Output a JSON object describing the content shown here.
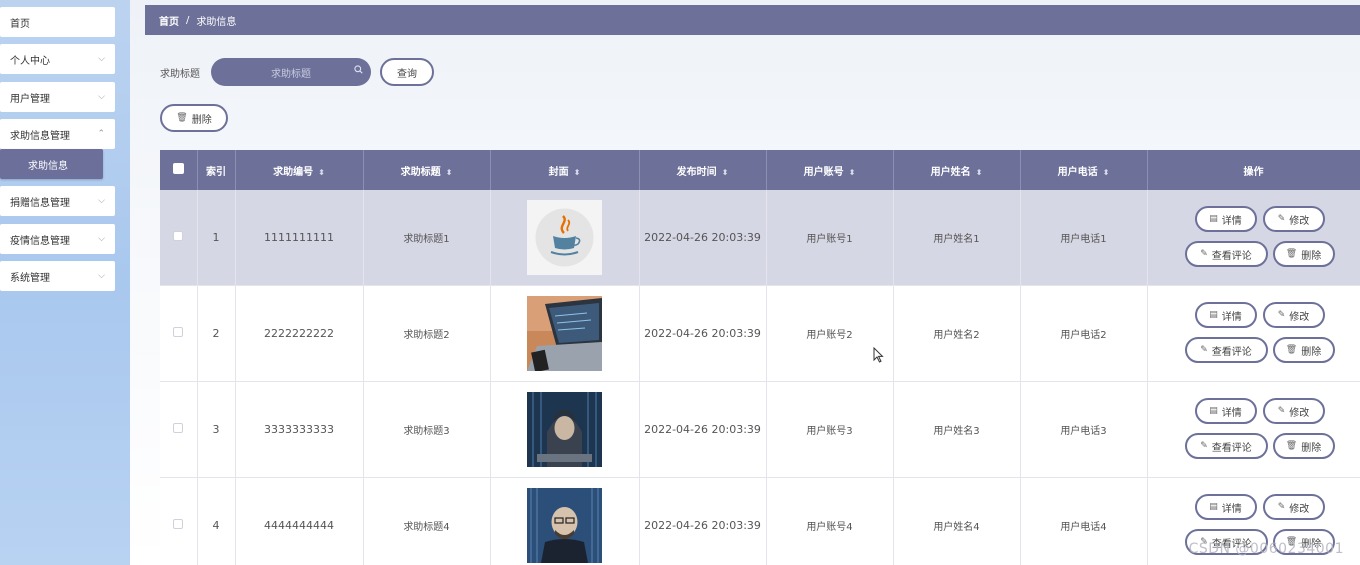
{
  "sidebar": {
    "items": [
      {
        "label": "首页",
        "chevron": false
      },
      {
        "label": "个人中心",
        "chevron": true
      },
      {
        "label": "用户管理",
        "chevron": true
      },
      {
        "label": "求助信息管理",
        "chevron": true,
        "sub": "求助信息"
      },
      {
        "label": "捐赠信息管理",
        "chevron": true
      },
      {
        "label": "疫情信息管理",
        "chevron": true
      },
      {
        "label": "系统管理",
        "chevron": true
      }
    ]
  },
  "breadcrumb": {
    "home": "首页",
    "separator": "/",
    "current": "求助信息"
  },
  "search": {
    "label": "求助标题",
    "placeholder": "求助标题",
    "query_button": "查询"
  },
  "toolbar": {
    "delete_button": "删除"
  },
  "table": {
    "headers": [
      "索引",
      "求助编号",
      "求助标题",
      "封面",
      "发布时间",
      "用户账号",
      "用户姓名",
      "用户电话",
      "操作"
    ],
    "rows": [
      {
        "index": "1",
        "code": "1111111111",
        "title": "求助标题1",
        "cover": "java-logo",
        "time": "2022-04-26 20:03:39",
        "account": "用户账号1",
        "name": "用户姓名1",
        "phone": "用户电话1"
      },
      {
        "index": "2",
        "code": "2222222222",
        "title": "求助标题2",
        "cover": "laptop-photo",
        "time": "2022-04-26 20:03:39",
        "account": "用户账号2",
        "name": "用户姓名2",
        "phone": "用户电话2"
      },
      {
        "index": "3",
        "code": "3333333333",
        "title": "求助标题3",
        "cover": "hacker-photo",
        "time": "2022-04-26 20:03:39",
        "account": "用户账号3",
        "name": "用户姓名3",
        "phone": "用户电话3"
      },
      {
        "index": "4",
        "code": "4444444444",
        "title": "求助标题4",
        "cover": "hacker-photo-2",
        "time": "2022-04-26 20:03:39",
        "account": "用户账号4",
        "name": "用户姓名4",
        "phone": "用户电话4"
      }
    ],
    "actions": {
      "detail": "详情",
      "edit": "修改",
      "comments": "查看评论",
      "delete": "删除"
    }
  },
  "watermark": "CSDN @0060234001",
  "colors": {
    "accent": "#6d7199",
    "selected_row": "#d6d7e4",
    "sidebar": "#b3cdef"
  }
}
